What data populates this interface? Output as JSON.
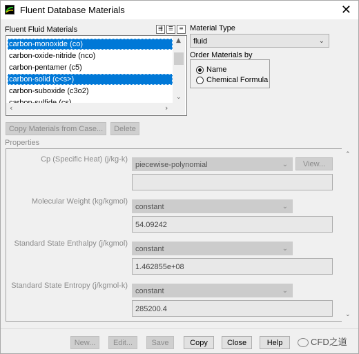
{
  "window": {
    "title": "Fluent Database Materials",
    "close_glyph": "✕"
  },
  "fluid_list": {
    "label": "Fluent Fluid Materials",
    "items": [
      {
        "label": "carbon-monoxide (co)",
        "selected": true
      },
      {
        "label": "carbon-oxide-nitride (nco)",
        "selected": false
      },
      {
        "label": "carbon-pentamer (c5)",
        "selected": false
      },
      {
        "label": "carbon-solid (c<s>)",
        "selected": true
      },
      {
        "label": "carbon-suboxide (c3o2)",
        "selected": false
      },
      {
        "label": "carbon-sulfide (cs)",
        "selected": false
      }
    ],
    "tool_icons": [
      "select-all-icon",
      "list-icon",
      "deselect-icon"
    ]
  },
  "material_type": {
    "label": "Material Type",
    "value": "fluid"
  },
  "order_by": {
    "label": "Order Materials by",
    "options": [
      {
        "label": "Name",
        "checked": true
      },
      {
        "label": "Chemical Formula",
        "checked": false
      }
    ]
  },
  "list_actions": {
    "copy_from_case": "Copy Materials from Case...",
    "delete": "Delete"
  },
  "properties": {
    "label": "Properties",
    "rows": [
      {
        "label": "Cp (Specific Heat) (j/kg-k)",
        "method": "piecewise-polynomial",
        "value": "",
        "button": "View..."
      },
      {
        "label": "Molecular Weight (kg/kgmol)",
        "method": "constant",
        "value": "54.09242"
      },
      {
        "label": "Standard State Enthalpy (j/kgmol)",
        "method": "constant",
        "value": "1.462855e+08"
      },
      {
        "label": "Standard State Entropy (j/kgmol-k)",
        "method": "constant",
        "value": "285200.4"
      }
    ]
  },
  "footer": {
    "new": "New...",
    "edit": "Edit...",
    "save": "Save",
    "copy": "Copy",
    "close": "Close",
    "help": "Help"
  },
  "watermark": {
    "text": "CFD之道"
  },
  "colors": {
    "selection": "#0078d7",
    "window_bg": "#f0f0f0"
  }
}
